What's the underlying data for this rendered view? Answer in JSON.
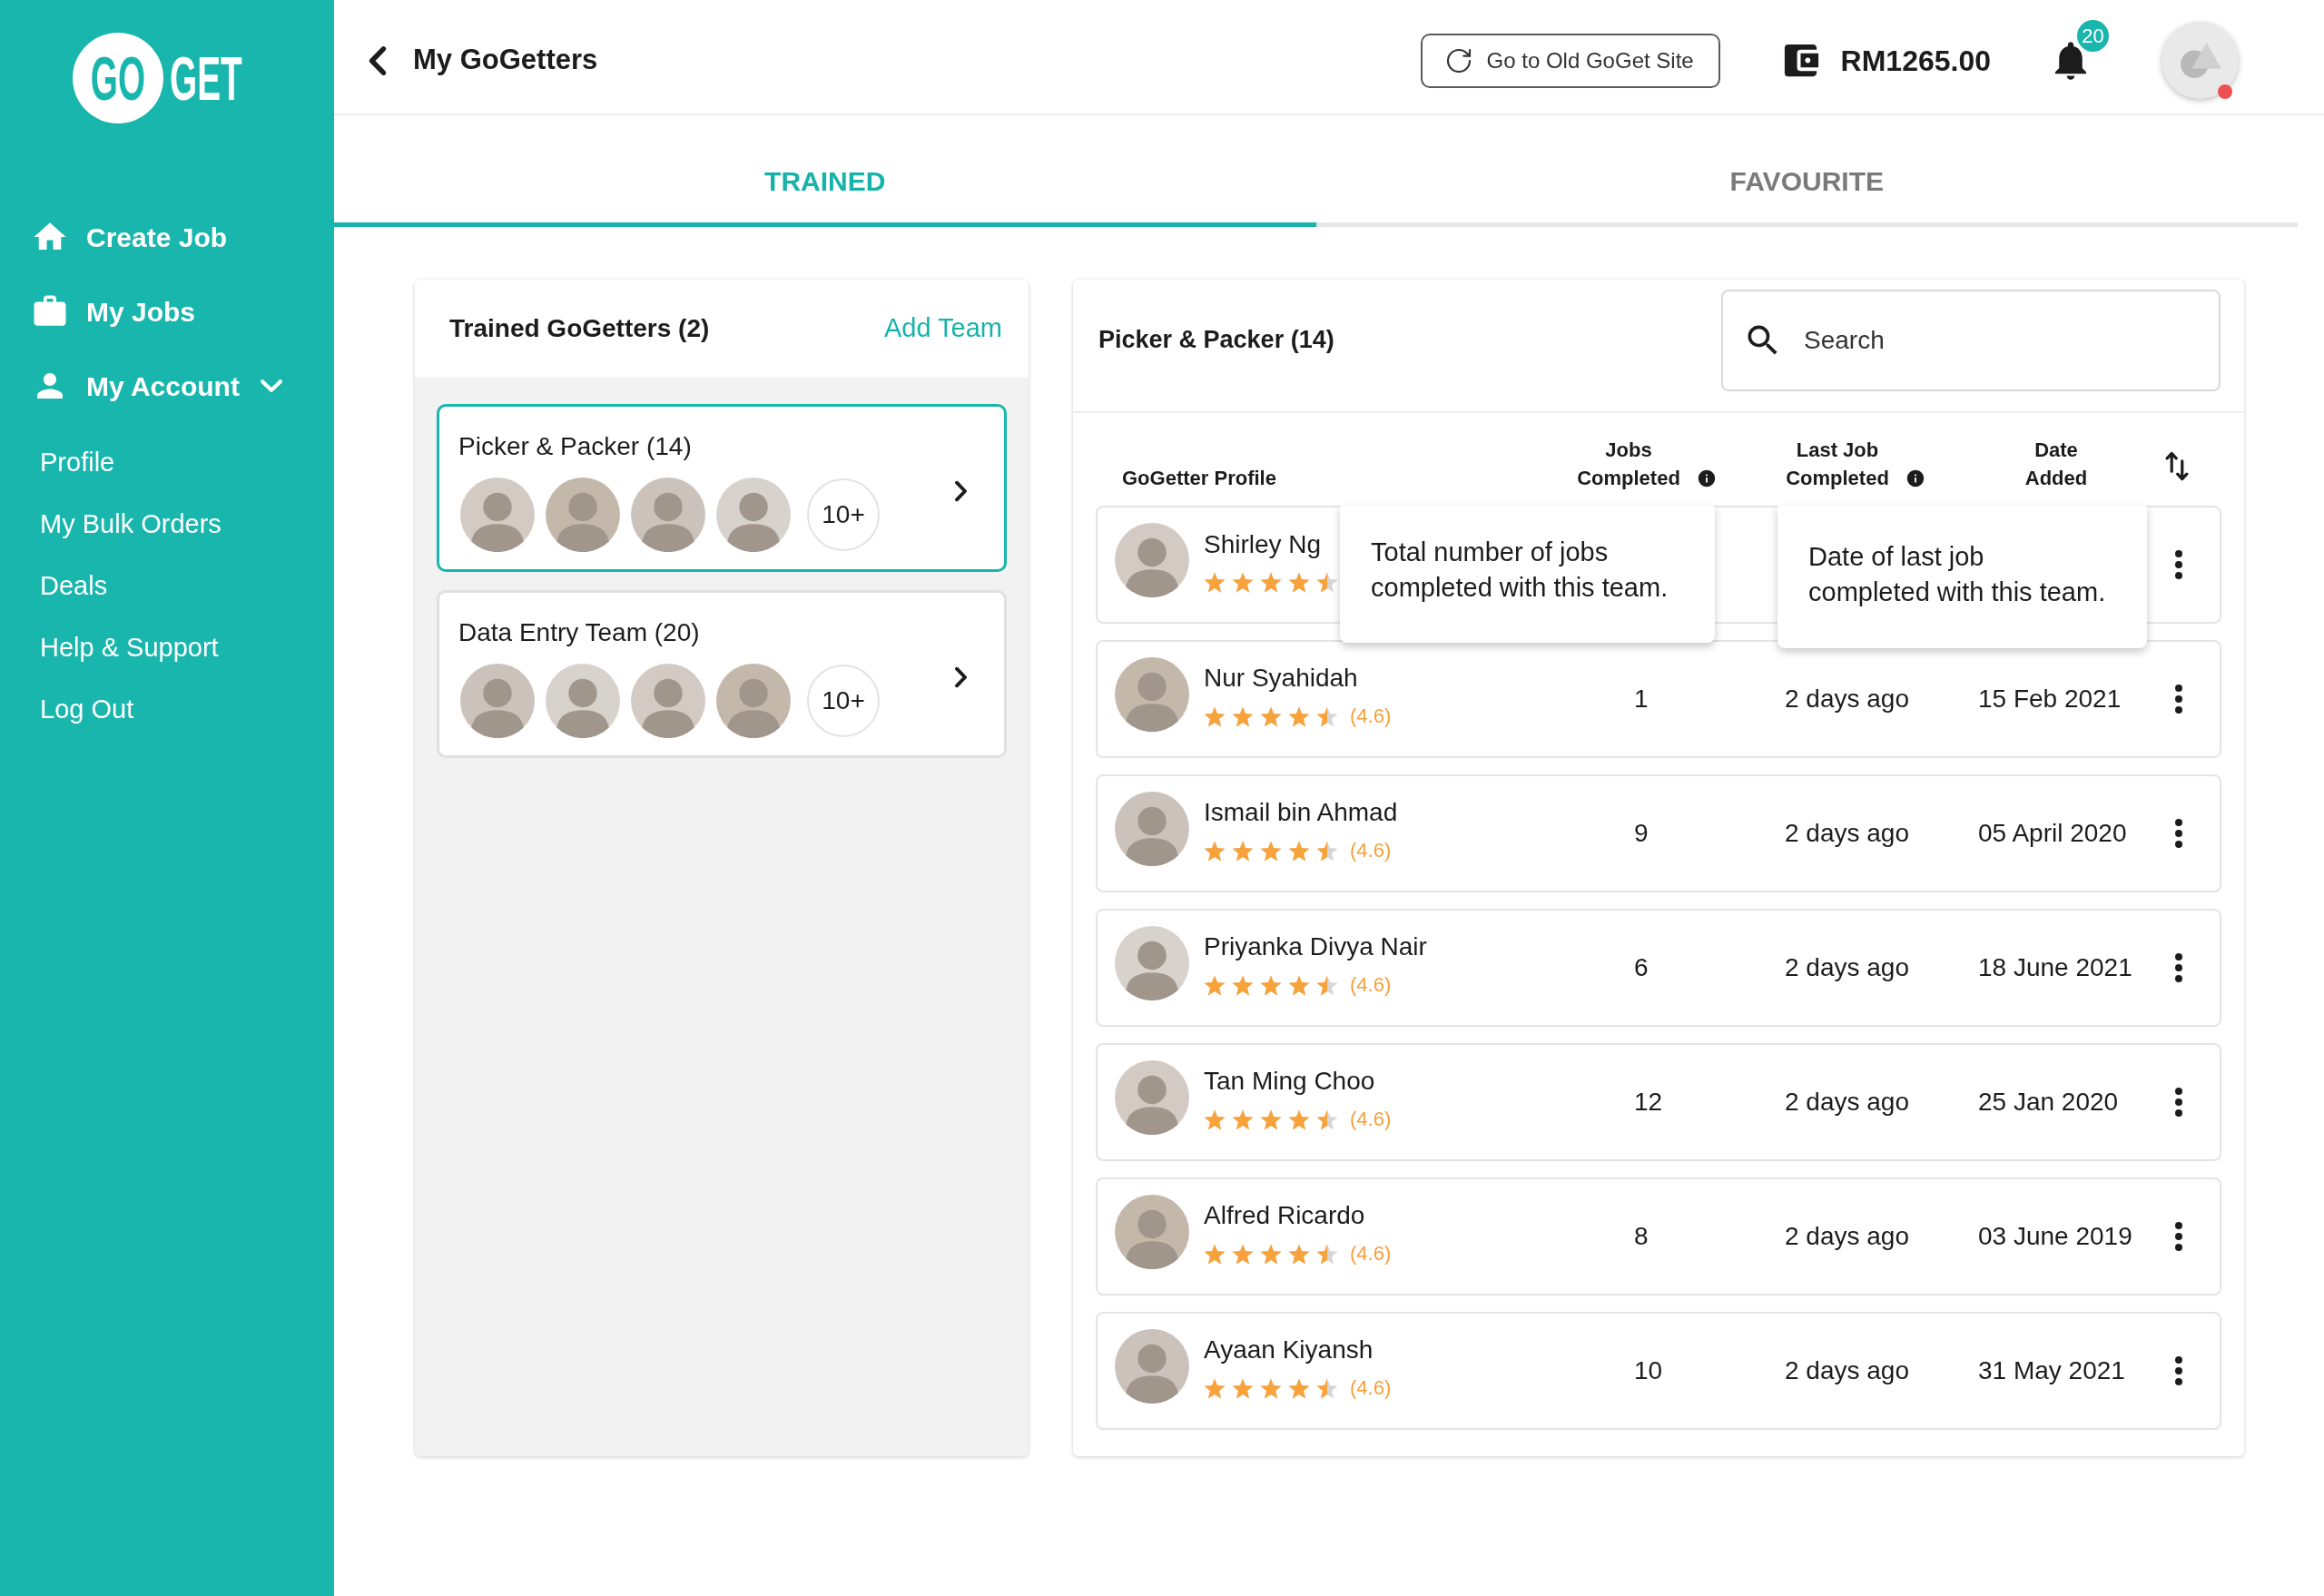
{
  "sidebar": {
    "logo": {
      "left": "GO",
      "right": "GET"
    },
    "items": [
      {
        "label": "Create Job"
      },
      {
        "label": "My Jobs"
      },
      {
        "label": "My Account",
        "expanded": true,
        "children": [
          {
            "label": "Profile"
          },
          {
            "label": "My Bulk Orders"
          },
          {
            "label": "Deals"
          },
          {
            "label": "Help & Support"
          },
          {
            "label": "Log Out"
          }
        ]
      }
    ]
  },
  "header": {
    "title": "My GoGetters",
    "old_site_button": "Go to Old GoGet Site",
    "balance": "RM1265.00",
    "notification_count": "20",
    "account_alert": true
  },
  "tabs": [
    {
      "label": "TRAINED",
      "selected": true
    },
    {
      "label": "FAVOURITE",
      "selected": false
    }
  ],
  "teams_panel": {
    "title": "Trained GoGetters (2)",
    "add_button": "Add Team",
    "teams": [
      {
        "name": "Picker & Packer (14)",
        "more": "10+",
        "selected": true
      },
      {
        "name": "Data Entry Team (20)",
        "more": "10+",
        "selected": false
      }
    ]
  },
  "members_panel": {
    "title": "Picker & Packer (14)",
    "search": {
      "placeholder": "Search"
    },
    "columns": [
      {
        "label": "GoGetter Profile"
      },
      {
        "label": "Jobs Completed",
        "tooltip": "Total number of jobs completed with this team."
      },
      {
        "label": "Last Job Completed",
        "tooltip": "Date of last job completed with this team."
      },
      {
        "label": "Date Added"
      }
    ],
    "rows": [
      {
        "name": "Shirley Ng",
        "stars": 4.5
      },
      {
        "name": "Nur Syahidah",
        "stars": 4.5,
        "rating": "(4.6)",
        "jobs": "1",
        "last_job": "2 days ago",
        "date_added": "15 Feb 2021"
      },
      {
        "name": "Ismail bin Ahmad",
        "stars": 4.5,
        "rating": "(4.6)",
        "jobs": "9",
        "last_job": "2 days ago",
        "date_added": "05 April 2020"
      },
      {
        "name": "Priyanka Divya Nair",
        "stars": 4.5,
        "rating": "(4.6)",
        "jobs": "6",
        "last_job": "2 days ago",
        "date_added": "18 June 2021"
      },
      {
        "name": "Tan Ming Choo",
        "stars": 4.5,
        "rating": "(4.6)",
        "jobs": "12",
        "last_job": "2 days ago",
        "date_added": "25 Jan 2020"
      },
      {
        "name": "Alfred Ricardo",
        "stars": 4.5,
        "rating": "(4.6)",
        "jobs": "8",
        "last_job": "2 days ago",
        "date_added": "03 June 2019"
      },
      {
        "name": "Ayaan Kiyansh",
        "stars": 4.5,
        "rating": "(4.6)",
        "jobs": "10",
        "last_job": "2 days ago",
        "date_added": "31 May 2021"
      }
    ]
  }
}
